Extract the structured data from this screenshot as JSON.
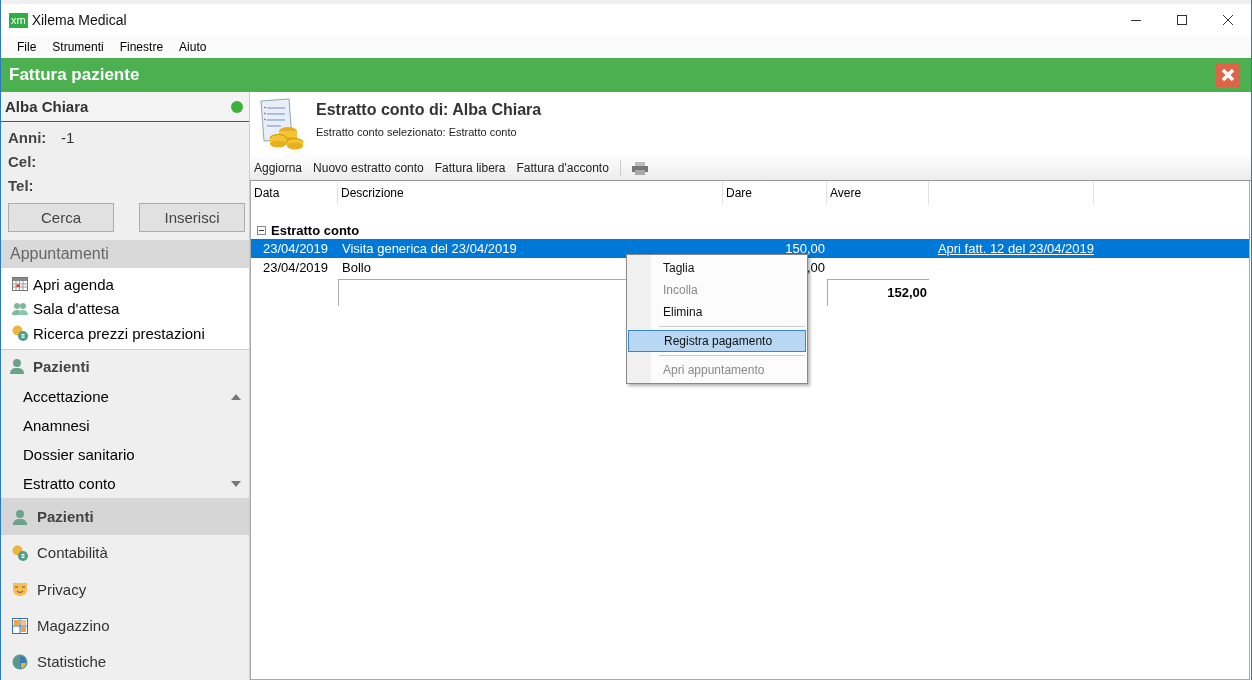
{
  "window": {
    "title": "Xilema Medical",
    "logo": "xm"
  },
  "menu": [
    "File",
    "Strumenti",
    "Finestre",
    "Aiuto"
  ],
  "header": {
    "title": "Fattura paziente"
  },
  "patient": {
    "name": "Alba Chiara",
    "online": true,
    "fields": [
      {
        "label": "Anni:",
        "value": "-1"
      },
      {
        "label": "Cel:"
      },
      {
        "label": "Tel:"
      }
    ],
    "buttons": [
      "Cerca",
      "Inserisci"
    ]
  },
  "appointments": {
    "title": "Appuntamenti",
    "items": [
      {
        "label": "Apri agenda"
      },
      {
        "label": "Sala d'attesa"
      },
      {
        "label": "Ricerca prezzi prestazioni"
      }
    ]
  },
  "patients_section": {
    "title": "Pazienti",
    "items": [
      {
        "label": "Accettazione"
      },
      {
        "label": "Anamnesi"
      },
      {
        "label": "Dossier sanitario"
      },
      {
        "label": "Estratto conto"
      }
    ]
  },
  "nav": [
    {
      "label": "Pazienti",
      "selected": true
    },
    {
      "label": "Contabilità",
      "selected": false
    },
    {
      "label": "Privacy",
      "selected": false
    },
    {
      "label": "Magazzino",
      "selected": false
    },
    {
      "label": "Statistiche",
      "selected": false
    }
  ],
  "statement": {
    "title": "Estratto conto di: Alba Chiara",
    "subtitle": "Estratto conto selezionato: Estratto conto"
  },
  "toolbar": [
    "Aggiorna",
    "Nuovo estratto conto",
    "Fattura libera",
    "Fattura d'acconto"
  ],
  "table": {
    "columns": [
      "Data",
      "Descrizione",
      "Dare",
      "Avere"
    ],
    "group": {
      "label": "Estratto conto",
      "expanded": true
    },
    "rows": [
      {
        "date": "23/04/2019",
        "description": "Visita generica del 23/04/2019",
        "dare": "150,00",
        "link": "Apri fatt. 12 del 23/04/2019",
        "selected": true
      },
      {
        "date": "23/04/2019",
        "description": "Bollo",
        "dare": ",00",
        "selected": false
      }
    ],
    "total": "152,00"
  },
  "context_menu": [
    {
      "kind": "item",
      "label": "Taglia",
      "disabled": false,
      "selected": false
    },
    {
      "kind": "item",
      "label": "Incolla",
      "disabled": true,
      "selected": false
    },
    {
      "kind": "item",
      "label": "Elimina",
      "disabled": false,
      "selected": false
    },
    {
      "kind": "separator"
    },
    {
      "kind": "item",
      "label": "Registra pagamento",
      "disabled": false,
      "selected": true
    },
    {
      "kind": "separator"
    },
    {
      "kind": "item",
      "label": "Apri appuntamento",
      "disabled": true,
      "selected": false
    }
  ]
}
